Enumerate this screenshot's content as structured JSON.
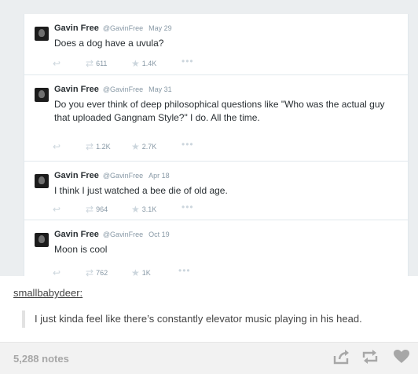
{
  "tweets": [
    {
      "author": "Gavin Free",
      "handle": "@GavinFree",
      "date": "May 29",
      "text": "Does a dog have a uvula?",
      "retweets": "611",
      "favorites": "1.4K"
    },
    {
      "author": "Gavin Free",
      "handle": "@GavinFree",
      "date": "May 31",
      "text": "Do you ever think of deep philosophical questions like \"Who was the actual guy that uploaded Gangnam Style?\" I do. All the time.",
      "retweets": "1.2K",
      "favorites": "2.7K"
    },
    {
      "author": "Gavin Free",
      "handle": "@GavinFree",
      "date": "Apr 18",
      "text": "I think I just watched a bee die of old age.",
      "retweets": "964",
      "favorites": "3.1K"
    },
    {
      "author": "Gavin Free",
      "handle": "@GavinFree",
      "date": "Oct 19",
      "text": "Moon is cool",
      "retweets": "762",
      "favorites": "1K"
    }
  ],
  "icons": {
    "reply": "reply-icon",
    "retweet": "retweet-icon",
    "favorite": "star-icon",
    "more": "more-dots-icon",
    "share": "share-icon",
    "reblog": "reblog-icon",
    "like": "heart-icon"
  },
  "post": {
    "poster": "smallbabydeer",
    "poster_suffix": ":",
    "comment": "I just kinda feel like there’s constantly elevator music playing in his head."
  },
  "footer": {
    "notes": "5,288 notes"
  }
}
